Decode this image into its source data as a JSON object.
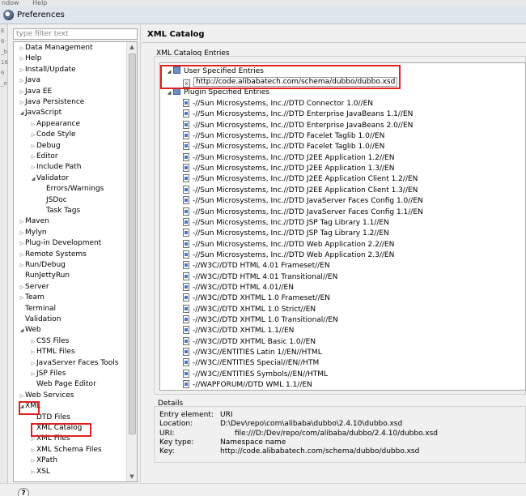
{
  "window": {
    "menu_fragments": [
      "ndow",
      "Help"
    ],
    "title": "Preferences"
  },
  "left_strip_fragments": [
    "E",
    "6-",
    "_b",
    "16",
    "6",
    "_e"
  ],
  "filter": {
    "placeholder": "type filter text"
  },
  "tree": [
    {
      "label": "Data Management",
      "level": 1,
      "twisty": "closed"
    },
    {
      "label": "Help",
      "level": 1,
      "twisty": "closed"
    },
    {
      "label": "Install/Update",
      "level": 1,
      "twisty": "closed"
    },
    {
      "label": "Java",
      "level": 1,
      "twisty": "closed"
    },
    {
      "label": "Java EE",
      "level": 1,
      "twisty": "closed"
    },
    {
      "label": "Java Persistence",
      "level": 1,
      "twisty": "closed"
    },
    {
      "label": "JavaScript",
      "level": 1,
      "twisty": "open"
    },
    {
      "label": "Appearance",
      "level": 2,
      "twisty": "closed"
    },
    {
      "label": "Code Style",
      "level": 2,
      "twisty": "closed"
    },
    {
      "label": "Debug",
      "level": 2,
      "twisty": "closed"
    },
    {
      "label": "Editor",
      "level": 2,
      "twisty": "closed"
    },
    {
      "label": "Include Path",
      "level": 2,
      "twisty": "closed"
    },
    {
      "label": "Validator",
      "level": 2,
      "twisty": "open"
    },
    {
      "label": "Errors/Warnings",
      "level": 3,
      "twisty": "none"
    },
    {
      "label": "JSDoc",
      "level": 3,
      "twisty": "none"
    },
    {
      "label": "Task Tags",
      "level": 3,
      "twisty": "none"
    },
    {
      "label": "Maven",
      "level": 1,
      "twisty": "closed"
    },
    {
      "label": "Mylyn",
      "level": 1,
      "twisty": "closed"
    },
    {
      "label": "Plug-in Development",
      "level": 1,
      "twisty": "closed"
    },
    {
      "label": "Remote Systems",
      "level": 1,
      "twisty": "closed"
    },
    {
      "label": "Run/Debug",
      "level": 1,
      "twisty": "closed"
    },
    {
      "label": "RunJettyRun",
      "level": 1,
      "twisty": "none"
    },
    {
      "label": "Server",
      "level": 1,
      "twisty": "closed"
    },
    {
      "label": "Team",
      "level": 1,
      "twisty": "closed"
    },
    {
      "label": "Terminal",
      "level": 1,
      "twisty": "none"
    },
    {
      "label": "Validation",
      "level": 1,
      "twisty": "none"
    },
    {
      "label": "Web",
      "level": 1,
      "twisty": "open"
    },
    {
      "label": "CSS Files",
      "level": 2,
      "twisty": "closed"
    },
    {
      "label": "HTML Files",
      "level": 2,
      "twisty": "closed"
    },
    {
      "label": "JavaServer Faces Tools",
      "level": 2,
      "twisty": "closed"
    },
    {
      "label": "JSP Files",
      "level": 2,
      "twisty": "closed"
    },
    {
      "label": "Web Page Editor",
      "level": 2,
      "twisty": "none"
    },
    {
      "label": "Web Services",
      "level": 1,
      "twisty": "closed"
    },
    {
      "label": "XML",
      "level": 1,
      "twisty": "open"
    },
    {
      "label": "DTD Files",
      "level": 2,
      "twisty": "none"
    },
    {
      "label": "XML Catalog",
      "level": 2,
      "twisty": "none"
    },
    {
      "label": "XML Files",
      "level": 2,
      "twisty": "closed"
    },
    {
      "label": "XML Schema Files",
      "level": 2,
      "twisty": "closed"
    },
    {
      "label": "XPath",
      "level": 2,
      "twisty": "closed"
    },
    {
      "label": "XSL",
      "level": 2,
      "twisty": "closed"
    }
  ],
  "page_title": "XML Catalog",
  "entries_group_label": "XML Catalog Entries",
  "user_specified": {
    "label": "User Specified Entries",
    "entry": "http://code.alibabatech.com/schema/dubbo/dubbo.xsd"
  },
  "plugin_specified": {
    "label": "Plugin Specified Entries",
    "entries": [
      "-//Sun Microsystems, Inc.//DTD Connector 1.0//EN",
      "-//Sun Microsystems, Inc.//DTD Enterprise JavaBeans 1.1//EN",
      "-//Sun Microsystems, Inc.//DTD Enterprise JavaBeans 2.0//EN",
      "-//Sun Microsystems, Inc.//DTD Facelet Taglib 1.0//EN",
      "-//Sun Microsystems, Inc.//DTD Facelet Taglib 1.0//EN",
      "-//Sun Microsystems, Inc.//DTD J2EE Application 1.2//EN",
      "-//Sun Microsystems, Inc.//DTD J2EE Application 1.3//EN",
      "-//Sun Microsystems, Inc.//DTD J2EE Application Client 1.2//EN",
      "-//Sun Microsystems, Inc.//DTD J2EE Application Client 1.3//EN",
      "-//Sun Microsystems, Inc.//DTD JavaServer Faces Config 1.0//EN",
      "-//Sun Microsystems, Inc.//DTD JavaServer Faces Config 1.1//EN",
      "-//Sun Microsystems, Inc.//DTD JSP Tag Library 1.1//EN",
      "-//Sun Microsystems, Inc.//DTD JSP Tag Library 1.2//EN",
      "-//Sun Microsystems, Inc.//DTD Web Application 2.2//EN",
      "-//Sun Microsystems, Inc.//DTD Web Application 2.3//EN",
      "-//W3C//DTD HTML 4.01 Frameset//EN",
      "-//W3C//DTD HTML 4.01 Transitional//EN",
      "-//W3C//DTD HTML 4.01//EN",
      "-//W3C//DTD XHTML 1.0 Frameset//EN",
      "-//W3C//DTD XHTML 1.0 Strict//EN",
      "-//W3C//DTD XHTML 1.0 Transitional//EN",
      "-//W3C//DTD XHTML 1.1//EN",
      "-//W3C//DTD XHTML Basic 1.0//EN",
      "-//W3C//ENTITIES Latin 1//EN//HTML",
      "-//W3C//ENTITIES Special//EN//HTM",
      "-//W3C//ENTITIES Symbols//EN//HTML",
      "-//WAPFORUM//DTD WML 1.1//EN"
    ]
  },
  "details": {
    "label": "Details",
    "rows": [
      {
        "key": "Entry element:",
        "value": "URI"
      },
      {
        "key": "Location:",
        "value": "D:\\Dev\\repo\\com\\alibaba\\dubbo\\2.4.10\\dubbo.xsd"
      },
      {
        "key": "URI:",
        "value": "file:///D:/Dev/repo/com/alibaba/dubbo/2.4.10/dubbo.xsd"
      },
      {
        "key": "Key type:",
        "value": "Namespace name"
      },
      {
        "key": "Key:",
        "value": "http://code.alibabatech.com/schema/dubbo/dubbo.xsd"
      }
    ]
  },
  "help_button": "?",
  "colors": {
    "highlight_box": "#e02020",
    "titlebar": "#dfe6ee"
  }
}
